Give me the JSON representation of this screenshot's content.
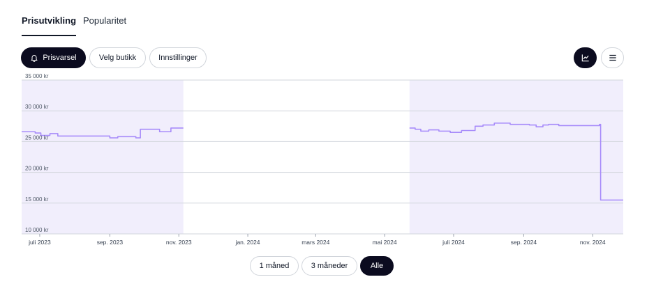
{
  "tabs": [
    {
      "label": "Prisutvikling",
      "active": true
    },
    {
      "label": "Popularitet",
      "active": false
    }
  ],
  "toolbar": {
    "price_alert_label": "Prisvarsel",
    "price_alert_icon": "bell-icon",
    "choose_store_label": "Velg butikk",
    "settings_label": "Innstillinger",
    "chart_view_icon": "line-chart-icon",
    "list_view_icon": "menu-icon"
  },
  "colors": {
    "accent_dark": "#0b0b1f",
    "series_line": "#a78bfa",
    "series_fill": "#f1eefc",
    "grid": "#d1d5db"
  },
  "chart_data": {
    "type": "area",
    "title": "",
    "xlabel": "",
    "ylabel": "",
    "ylim": [
      10000,
      35000
    ],
    "yticks": [
      {
        "value": 10000,
        "label": "10 000 kr"
      },
      {
        "value": 15000,
        "label": "15 000 kr"
      },
      {
        "value": 20000,
        "label": "20 000 kr"
      },
      {
        "value": 25000,
        "label": "25 000 kr"
      },
      {
        "value": 30000,
        "label": "30 000 kr"
      },
      {
        "value": 35000,
        "label": "35 000 kr"
      }
    ],
    "xlim": [
      "2023-06-15",
      "2024-11-28"
    ],
    "xticks": [
      {
        "date": "2023-07-01",
        "label": "juli 2023"
      },
      {
        "date": "2023-09-01",
        "label": "sep. 2023"
      },
      {
        "date": "2023-11-01",
        "label": "nov. 2023"
      },
      {
        "date": "2024-01-01",
        "label": "jan. 2024"
      },
      {
        "date": "2024-03-01",
        "label": "mars 2024"
      },
      {
        "date": "2024-05-01",
        "label": "mai 2024"
      },
      {
        "date": "2024-07-01",
        "label": "juli 2024"
      },
      {
        "date": "2024-09-01",
        "label": "sep. 2024"
      },
      {
        "date": "2024-11-01",
        "label": "nov. 2024"
      }
    ],
    "grid": true,
    "step": true,
    "series": [
      {
        "segments": [
          [
            {
              "x": "2023-06-15",
              "y": 26600
            },
            {
              "x": "2023-06-27",
              "y": 26400
            },
            {
              "x": "2023-07-02",
              "y": 26000
            },
            {
              "x": "2023-07-10",
              "y": 26300
            },
            {
              "x": "2023-07-17",
              "y": 25900
            },
            {
              "x": "2023-09-01",
              "y": 25600
            },
            {
              "x": "2023-09-08",
              "y": 25800
            },
            {
              "x": "2023-09-24",
              "y": 25600
            },
            {
              "x": "2023-09-28",
              "y": 27000
            },
            {
              "x": "2023-10-15",
              "y": 26600
            },
            {
              "x": "2023-10-25",
              "y": 27200
            },
            {
              "x": "2023-11-05",
              "y": 27200
            }
          ],
          [
            {
              "x": "2024-05-23",
              "y": 27200
            },
            {
              "x": "2024-05-28",
              "y": 27000
            },
            {
              "x": "2024-06-02",
              "y": 26700
            },
            {
              "x": "2024-06-09",
              "y": 26900
            },
            {
              "x": "2024-06-18",
              "y": 26700
            },
            {
              "x": "2024-06-28",
              "y": 26500
            },
            {
              "x": "2024-07-08",
              "y": 26800
            },
            {
              "x": "2024-07-20",
              "y": 27500
            },
            {
              "x": "2024-07-27",
              "y": 27700
            },
            {
              "x": "2024-08-06",
              "y": 28000
            },
            {
              "x": "2024-08-20",
              "y": 27800
            },
            {
              "x": "2024-09-06",
              "y": 27700
            },
            {
              "x": "2024-09-12",
              "y": 27400
            },
            {
              "x": "2024-09-18",
              "y": 27700
            },
            {
              "x": "2024-09-23",
              "y": 27800
            },
            {
              "x": "2024-10-02",
              "y": 27600
            },
            {
              "x": "2024-11-07",
              "y": 27800
            },
            {
              "x": "2024-11-08",
              "y": 15500
            },
            {
              "x": "2024-11-28",
              "y": 15500
            }
          ]
        ]
      }
    ]
  },
  "ranges": {
    "one_month_label": "1 måned",
    "three_months_label": "3 måneder",
    "all_label": "Alle",
    "selected": "Alle"
  }
}
